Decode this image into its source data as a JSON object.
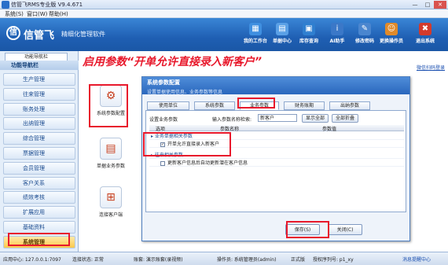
{
  "window": {
    "title": "信管飞RMS专业版 V9.4.671",
    "min": "—",
    "max": "□",
    "close": "✕"
  },
  "menu": [
    "系统(S)",
    "窗口(W)",
    "帮助(H)"
  ],
  "banner": {
    "logo_mark": "信",
    "logo_text": "信管飞",
    "tagline": "精细化管理软件"
  },
  "toolbar": [
    {
      "label": "我的工作台",
      "icon": "desktop-icon",
      "glyph": "▦",
      "color": "#3f8fe0"
    },
    {
      "label": "单据中心",
      "icon": "document-icon",
      "glyph": "▤",
      "color": "#5aa0e6"
    },
    {
      "label": "库存查询",
      "icon": "warehouse-icon",
      "glyph": "▣",
      "color": "#2f7fd0"
    },
    {
      "label": "AI助手",
      "icon": "info-icon",
      "glyph": "i",
      "color": "#3b78c8"
    },
    {
      "label": "修改密码",
      "icon": "lock-icon",
      "glyph": "✎",
      "color": "#4a86cf"
    },
    {
      "label": "更换操作员",
      "icon": "user-switch-icon",
      "glyph": "☺",
      "color": "#e08a2a"
    },
    {
      "label": "退出系统",
      "icon": "exit-icon",
      "glyph": "✖",
      "color": "#d33a2c"
    }
  ],
  "nav": {
    "tab": "功能导航栏",
    "title": "功能导航栏",
    "items": [
      "生产管理",
      "往来管理",
      "账务处理",
      "出纳管理",
      "综合管理",
      "票据管理",
      "会员管理",
      "客户关系",
      "绩效考核",
      "扩展应用",
      "基础资料",
      "系统管理"
    ],
    "selected": "系统管理"
  },
  "mid_tiles": [
    {
      "label": "系统参数配置",
      "icon": "settings-db-icon",
      "glyph": "⚙"
    },
    {
      "label": "单据业务参数",
      "icon": "form-icon",
      "glyph": "▤"
    },
    {
      "label": "连接客户端",
      "icon": "network-icon",
      "glyph": "⊞"
    }
  ],
  "annotation": "启用参数“开单允许直接录入新客户”",
  "page_link": "微信扫码登录",
  "dialog": {
    "title": "系统参数配置",
    "subtitle": "设置单据使用信息、业务参数等信息",
    "tabs": [
      "使用单位",
      "系统参数",
      "业务参数",
      "财务账期",
      "出纳参数"
    ],
    "active_tab": "业务参数",
    "toolbar_label": "设置业务参数",
    "search_label": "输入参数名称检索:",
    "search_value": "新客户",
    "show_all": "显示全部",
    "collapse_all": "全部折叠",
    "columns": [
      "选项",
      "参数名称",
      "参数值"
    ],
    "groups": [
      {
        "name": "业务单据相关参数",
        "rows": [
          {
            "checked": true,
            "label": "开单允许直接录入新客户"
          }
        ]
      },
      {
        "name": "往来相关参数",
        "rows": [
          {
            "checked": false,
            "label": "更新客户信息后自动更新潜在客户信息"
          }
        ]
      }
    ],
    "save": "保存(S)",
    "close": "关闭(C)"
  },
  "status": {
    "app_center": "应用中心: 127.0.0.1:7097",
    "conn": "连接状态: 正常",
    "account": "账套: 演示账套(录视频)",
    "operator": "操作员: 系统管理员(admin)",
    "edition": "正式版",
    "license": "授权序列号: p1_xy",
    "msg": "消息提醒中心"
  }
}
